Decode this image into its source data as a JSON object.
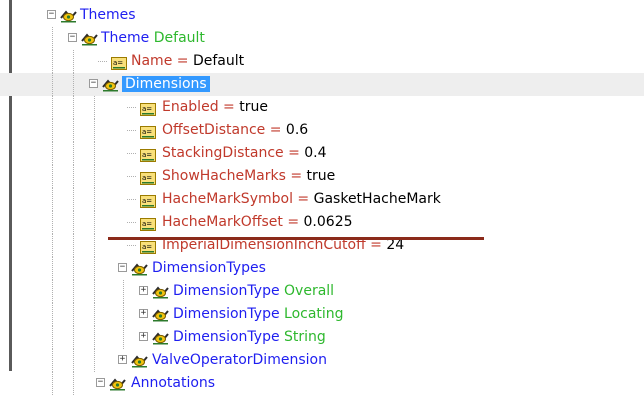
{
  "tree": {
    "rows": [
      {
        "kind": "node",
        "depth": 0,
        "expander": "minus",
        "name": "Themes",
        "value": ""
      },
      {
        "kind": "node",
        "depth": 1,
        "expander": "minus",
        "name": "Theme",
        "value": "Default"
      },
      {
        "kind": "prop",
        "depth": 2,
        "name": "Name",
        "eq": "=",
        "value": "Default"
      },
      {
        "kind": "node",
        "depth": 2,
        "expander": "minus",
        "name": "Dimensions",
        "value": "",
        "selected": true
      },
      {
        "kind": "prop",
        "depth": 3,
        "name": "Enabled",
        "eq": "=",
        "value": "true"
      },
      {
        "kind": "prop",
        "depth": 3,
        "name": "OffsetDistance",
        "eq": "=",
        "value": "0.6"
      },
      {
        "kind": "prop",
        "depth": 3,
        "name": "StackingDistance",
        "eq": "=",
        "value": "0.4"
      },
      {
        "kind": "prop",
        "depth": 3,
        "name": "ShowHacheMarks",
        "eq": "=",
        "value": "true"
      },
      {
        "kind": "prop",
        "depth": 3,
        "name": "HacheMarkSymbol",
        "eq": "=",
        "value": "GasketHacheMark"
      },
      {
        "kind": "prop",
        "depth": 3,
        "name": "HacheMarkOffset",
        "eq": "=",
        "value": "0.0625"
      },
      {
        "kind": "prop",
        "depth": 3,
        "name": "ImperialDimensionInchCutoff",
        "eq": "=",
        "value": "24"
      },
      {
        "kind": "node",
        "depth": 3,
        "expander": "minus",
        "name": "DimensionTypes",
        "value": ""
      },
      {
        "kind": "node",
        "depth": 4,
        "expander": "plus",
        "name": "DimensionType",
        "value": "Overall"
      },
      {
        "kind": "node",
        "depth": 4,
        "expander": "plus",
        "name": "DimensionType",
        "value": "Locating"
      },
      {
        "kind": "node",
        "depth": 4,
        "expander": "plus",
        "name": "DimensionType",
        "value": "String"
      },
      {
        "kind": "node",
        "depth": 3,
        "expander": "plus",
        "name": "ValveOperatorDimension",
        "value": ""
      },
      {
        "kind": "node",
        "depth": 2,
        "expander": "minus",
        "name": "Annotations",
        "value": ""
      }
    ]
  },
  "icons": {
    "node_icon": "element-node-icon",
    "property_icon": "attribute-property-icon",
    "expander_minus": "collapse-icon",
    "expander_plus": "expand-icon"
  },
  "colors": {
    "node_name": "#1e1ef0",
    "node_value": "#2eb82e",
    "property_name": "#c0392b",
    "property_value": "#000000",
    "selection": "#3399ff",
    "annotation_underline": "#8b2a1a"
  }
}
